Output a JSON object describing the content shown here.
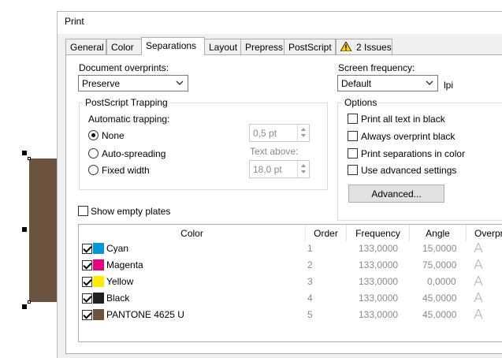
{
  "dialog": {
    "title": "Print"
  },
  "tabs": [
    {
      "label": "General"
    },
    {
      "label": "Color"
    },
    {
      "label": "Separations"
    },
    {
      "label": "Layout"
    },
    {
      "label": "Prepress"
    },
    {
      "label": "PostScript"
    },
    {
      "label": "2 Issues"
    }
  ],
  "active_tab": "Separations",
  "document_overprints": {
    "label": "Document overprints:",
    "value": "Preserve"
  },
  "screen_frequency": {
    "label": "Screen frequency:",
    "value": "Default",
    "unit": "lpi"
  },
  "trapping": {
    "group_label": "PostScript Trapping",
    "automatic_label": "Automatic trapping:",
    "options": [
      {
        "label": "None",
        "selected": true
      },
      {
        "label": "Auto-spreading",
        "selected": false
      },
      {
        "label": "Fixed width",
        "selected": false
      }
    ],
    "spin1_value": "0,5 pt",
    "text_above_label": "Text above:",
    "spin2_value": "18,0 pt"
  },
  "options": {
    "group_label": "Options",
    "items": [
      {
        "label": "Print all text in black",
        "checked": false
      },
      {
        "label": "Always overprint black",
        "checked": false
      },
      {
        "label": "Print separations in color",
        "checked": false
      },
      {
        "label": "Use advanced settings",
        "checked": false
      }
    ],
    "advanced_button": "Advanced..."
  },
  "show_empty_plates": {
    "label": "Show empty plates",
    "checked": false
  },
  "table": {
    "headers": [
      "Color",
      "Order",
      "Frequency",
      "Angle",
      "Overpri"
    ],
    "rows": [
      {
        "checked": true,
        "color": "#0097d8",
        "name": "Cyan",
        "order": "1",
        "frequency": "133,0000",
        "angle": "15,0000"
      },
      {
        "checked": true,
        "color": "#e5007e",
        "name": "Magenta",
        "order": "2",
        "frequency": "133,0000",
        "angle": "75,0000"
      },
      {
        "checked": true,
        "color": "#ffeb00",
        "name": "Yellow",
        "order": "3",
        "frequency": "133,0000",
        "angle": "0,0000"
      },
      {
        "checked": true,
        "color": "#231f20",
        "name": "Black",
        "order": "4",
        "frequency": "133,0000",
        "angle": "45,0000"
      },
      {
        "checked": true,
        "color": "#6b5340",
        "name": "PANTONE 4625 U",
        "order": "5",
        "frequency": "133,0000",
        "angle": "45,0000"
      }
    ]
  }
}
